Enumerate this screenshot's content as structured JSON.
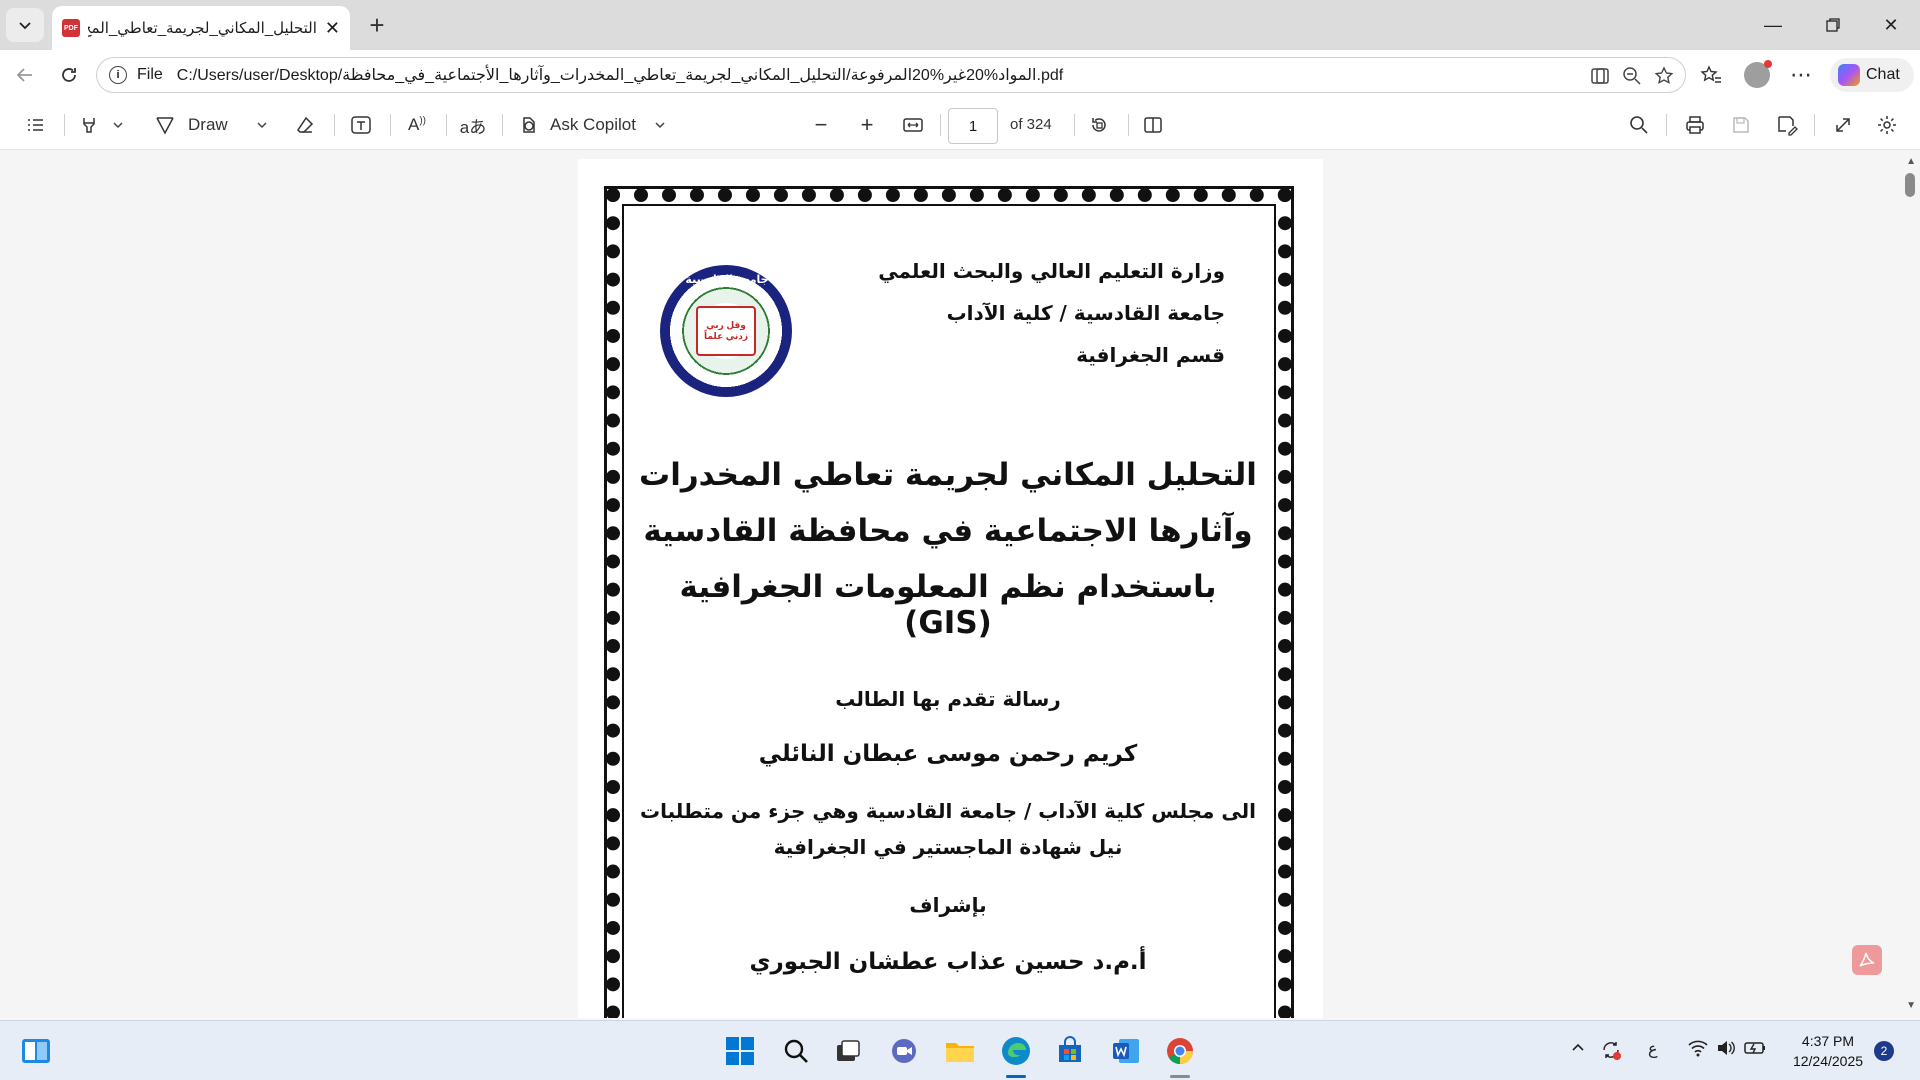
{
  "browser": {
    "tab_title": "التحليل_المكاني_لجريمة_تعاطي_المخ",
    "tab_icon_text": "PDF",
    "address_scheme": "File",
    "address_url": "C:/Users/user/Desktop/المواد%20غير%20المرفوعة/التحليل_المكاني_لجريمة_تعاطي_المخدرات_وآثارها_الأجتماعية_في_محافظة.pdf",
    "chat_label": "Chat"
  },
  "pdf_toolbar": {
    "draw_label": "Draw",
    "ask_copilot_label": "Ask Copilot",
    "current_page": "1",
    "total_pages": "of 324"
  },
  "document": {
    "ministry_lines": [
      "وزارة التعليم العالي والبحث العلمي",
      "جامعة القادسية / كلية الآداب",
      "قسم الجغرافية"
    ],
    "seal_text": "جامعة القادسية",
    "seal_motto": "وقل ربي زدني علماً",
    "title_lines": [
      "التحليل المكاني لجريمة تعاطي المخدرات",
      "وآثارها الاجتماعية في محافظة القادسية",
      "باستخدام نظم المعلومات الجغرافية (GIS)"
    ],
    "submitted_by": "رسالة تقدم بها الطالب",
    "student_name": "كريم رحمن موسى عبطان النائلي",
    "purpose_line1": "الى مجلس كلية الآداب / جامعة القادسية وهي جزء من متطلبات",
    "purpose_line2": "نيل شهادة الماجستير في الجغرافية",
    "supervision": "بإشراف",
    "supervisor": "أ.م.د حسين عذاب عطشان الجبوري"
  },
  "taskbar": {
    "time": "4:37 PM",
    "date": "12/24/2025",
    "notification_count": "2",
    "lang": "ع"
  },
  "colors": {
    "pdf_red": "#d13438",
    "taskbar_bg": "#e7edf6"
  }
}
